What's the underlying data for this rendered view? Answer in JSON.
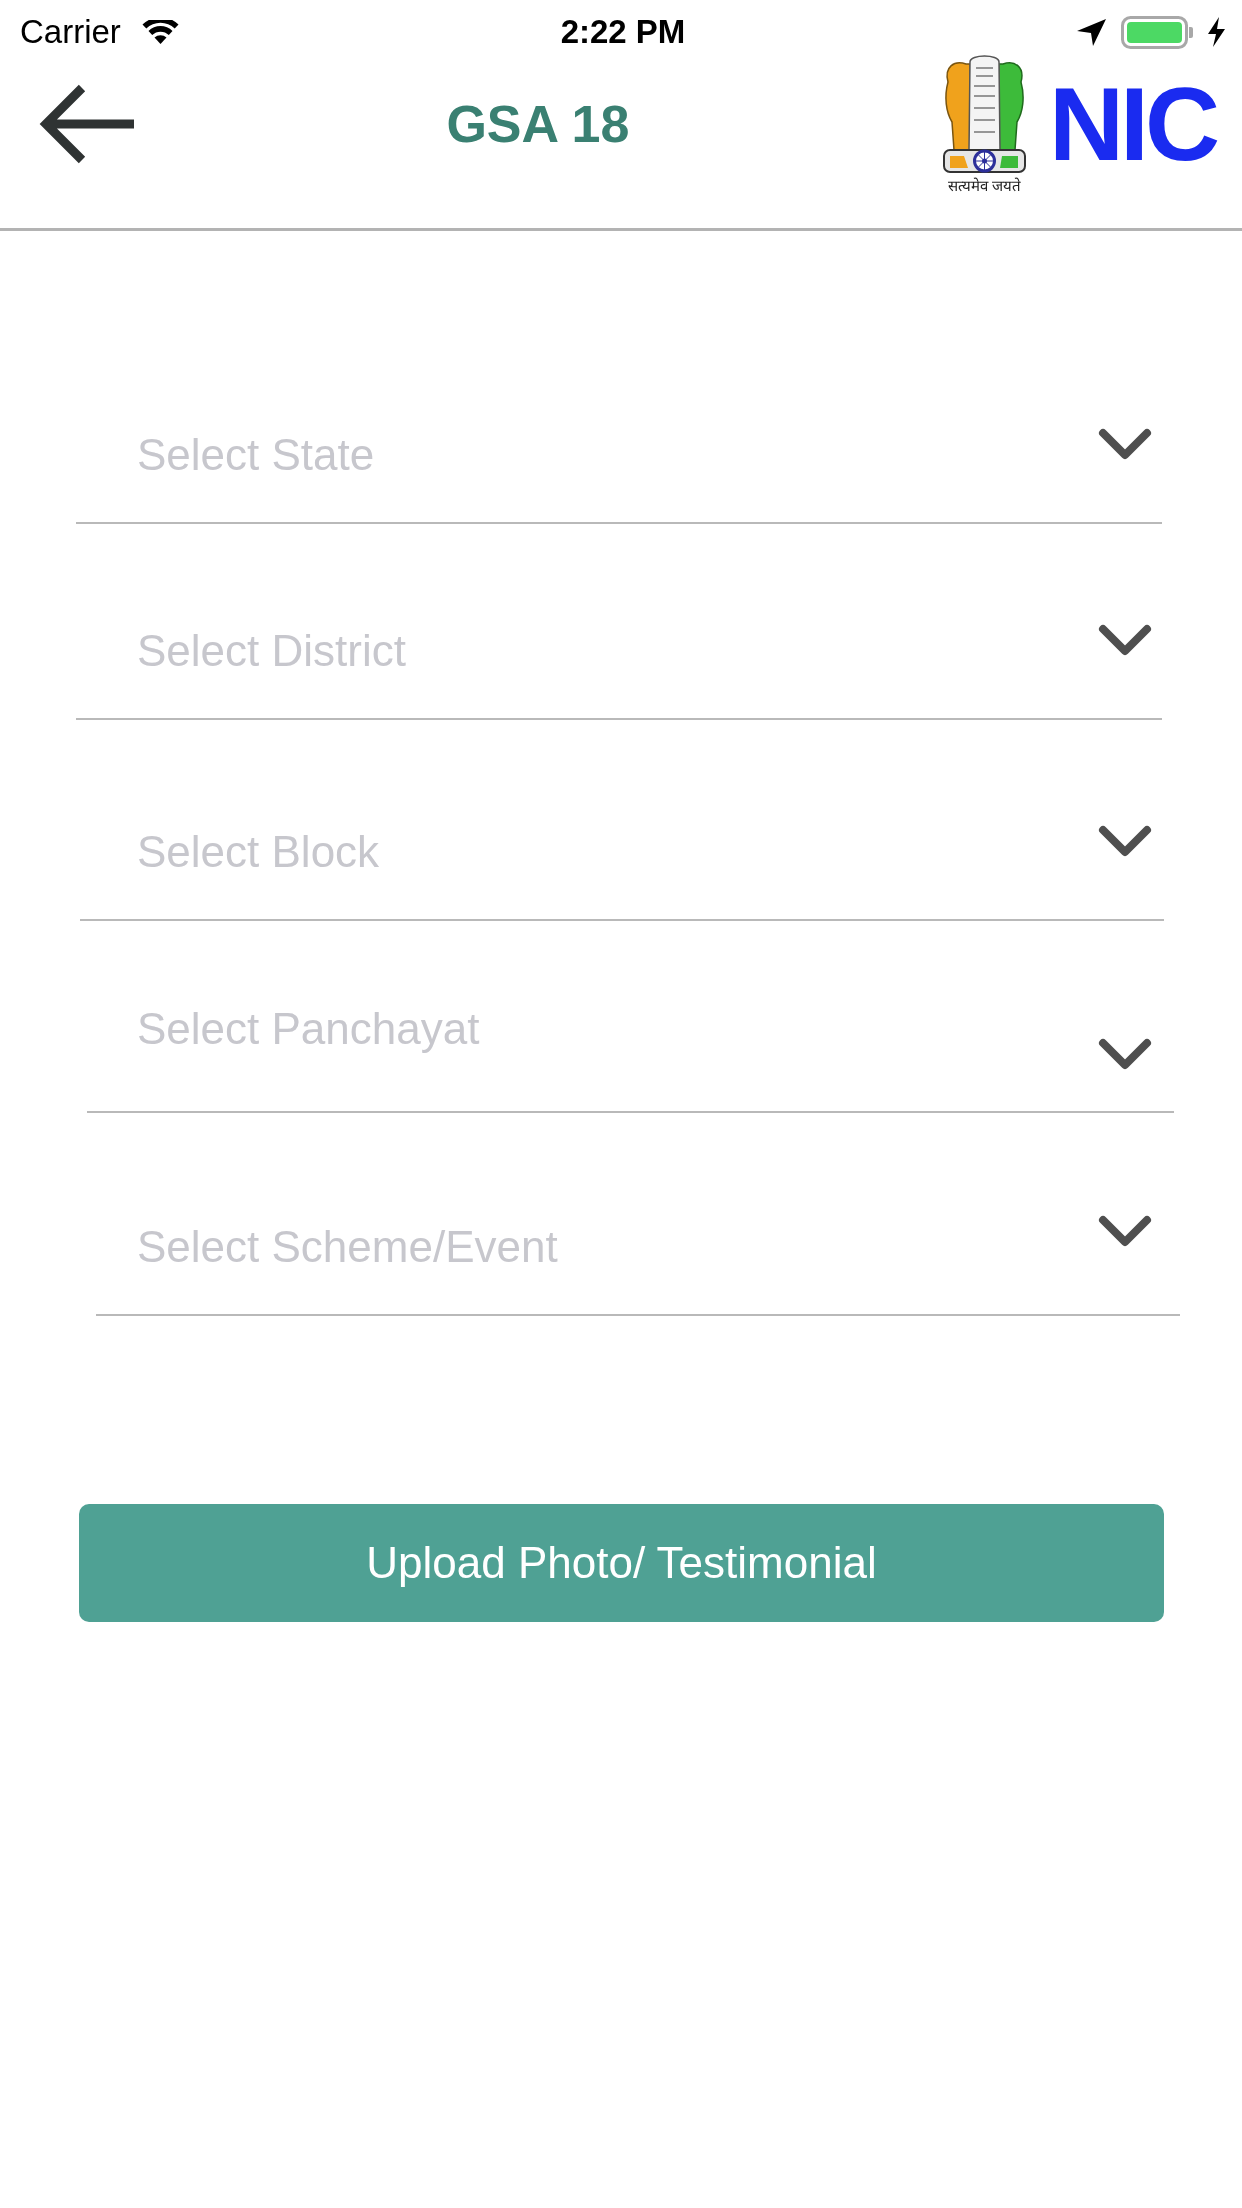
{
  "status_bar": {
    "carrier": "Carrier",
    "time": "2:22 PM"
  },
  "header": {
    "title": "GSA 18",
    "emblem_motto": "सत्यमेव जयते",
    "nic_logo": "NIC"
  },
  "fields": [
    {
      "placeholder": "Select State"
    },
    {
      "placeholder": "Select District"
    },
    {
      "placeholder": "Select Block"
    },
    {
      "placeholder": "Select Panchayat"
    },
    {
      "placeholder": "Select Scheme/Event"
    }
  ],
  "upload_button": {
    "label": "Upload Photo/ Testimonial"
  }
}
